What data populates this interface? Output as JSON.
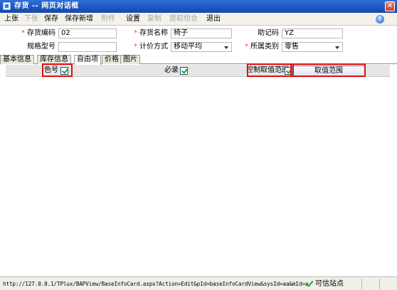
{
  "window": {
    "title": "存货 -- 网页对话框",
    "close_label": "✕"
  },
  "toolbar": {
    "items": [
      {
        "label": "上张",
        "enabled": true
      },
      {
        "label": "下张",
        "enabled": false
      },
      {
        "label": "保存",
        "enabled": true
      },
      {
        "label": "保存新增",
        "enabled": true
      },
      {
        "label": "附件",
        "enabled": false
      },
      {
        "label": "设置",
        "enabled": true
      },
      {
        "label": "复制",
        "enabled": false
      },
      {
        "label": "提取组合",
        "enabled": false
      },
      {
        "label": "退出",
        "enabled": true
      }
    ],
    "help_label": "?"
  },
  "form": {
    "code_label": "存货编码",
    "code_value": "02",
    "name_label": "存货名称",
    "name_value": "椅子",
    "mnemonic_label": "助记码",
    "mnemonic_value": "YZ",
    "spec_label": "规格型号",
    "spec_value": "",
    "pricing_label": "计价方式",
    "pricing_value": "移动平均",
    "category_label": "所属类别",
    "category_value": "零售",
    "required_marker": "*"
  },
  "tabs": [
    {
      "label": "基本信息",
      "active": false
    },
    {
      "label": "库存信息",
      "active": false
    },
    {
      "label": "自由项",
      "active": true
    },
    {
      "label": "价格",
      "active": false
    },
    {
      "label": "图片",
      "active": false
    }
  ],
  "custom_items": {
    "color_label": "色号",
    "color_checked": true,
    "required_label": "必录",
    "required_checked": true,
    "range_label": "控制取值范围",
    "range_checked": true,
    "range_button": "取值范围"
  },
  "status": {
    "url": "http://127.0.0.1/TPlux/BAPView/BaseInfoCard.aspx?Action=Edit&pId=baseInfoCardView&sysId=aa&mId=a",
    "trust": "可信站点"
  },
  "colors": {
    "titlebar": "#1e58c2",
    "highlight_box": "#e01010",
    "required_marker": "#e05a2a",
    "check": "#22a32a"
  }
}
